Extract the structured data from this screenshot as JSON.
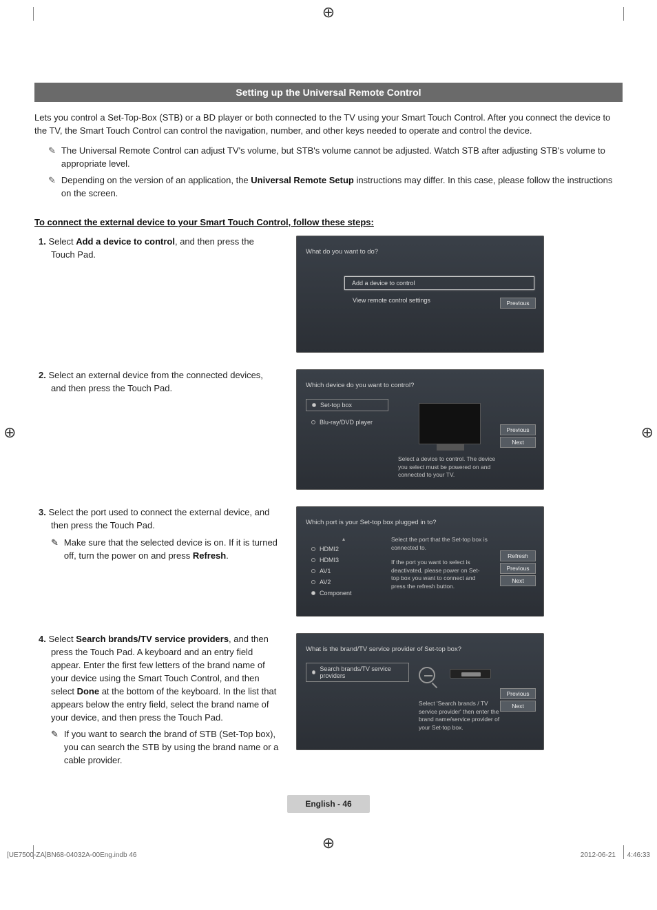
{
  "heading": "Setting up the Universal Remote Control",
  "intro": "Lets you control a Set-Top-Box (STB) or a BD player or both connected to the TV using your Smart Touch Control. After you connect the device to the TV, the Smart Touch Control can control the navigation, number, and other keys needed to operate and control the device.",
  "notes": [
    "The Universal Remote Control can adjust TV's volume, but STB's volume cannot be adjusted. Watch STB after adjusting STB's volume to appropriate level.",
    "Depending on the version of an application, the Universal Remote Setup instructions may differ. In this case, please follow the instructions on the screen."
  ],
  "note2_bold": "Universal Remote Setup",
  "subheading": "To connect the external device to your Smart Touch Control, follow these steps:",
  "steps": {
    "s1": {
      "num": "1.",
      "text_prefix": "Select ",
      "bold": "Add a device to control",
      "text_suffix": ", and then press the Touch Pad."
    },
    "s2": {
      "num": "2.",
      "text": "Select an external device from the connected devices, and then press the Touch Pad."
    },
    "s3": {
      "num": "3.",
      "text": "Select the port used to connect the external device, and then press the Touch Pad.",
      "note_prefix": "Make sure that the selected device is on. If it is turned off, turn the power on and press ",
      "note_bold": "Refresh",
      "note_suffix": "."
    },
    "s4": {
      "num": "4.",
      "text_prefix": "Select ",
      "bold1": "Search brands/TV service providers",
      "mid": ", and then press the Touch Pad. A keyboard and an entry field appear. Enter the first few letters of the brand name of your device using the Smart Touch Control, and then select ",
      "bold2": "Done",
      "suffix": " at the bottom of the keyboard. In the list that appears below the entry field, select the brand name of your device, and then press the Touch Pad.",
      "note": "If you want to search the brand of STB (Set-Top box), you can search the STB by using the brand name or a cable provider."
    }
  },
  "screen1": {
    "title": "What do you want to do?",
    "opt1": "Add a device to control",
    "opt2": "View remote control settings",
    "previous": "Previous"
  },
  "screen2": {
    "title": "Which device do you want to control?",
    "opt1": "Set-top box",
    "opt2": "Blu-ray/DVD player",
    "helper": "Select a device to control. The device you select must be powered on and connected to your TV.",
    "previous": "Previous",
    "next": "Next"
  },
  "screen3": {
    "title": "Which port is your Set-top box plugged in to?",
    "ports": [
      "HDMI2",
      "HDMI3",
      "AV1",
      "AV2",
      "Component"
    ],
    "helper1": "Select the port that the Set-top box is connected to.",
    "helper2": "If the port you want to select is deactivated, please power on Set-top box you want to connect and press the refresh button.",
    "refresh": "Refresh",
    "previous": "Previous",
    "next": "Next"
  },
  "screen4": {
    "title": "What is the brand/TV service provider of Set-top box?",
    "opt1": "Search brands/TV service providers",
    "helper": "Select 'Search brands / TV service provider' then enter the brand name/service provider of your Set-top box.",
    "previous": "Previous",
    "next": "Next"
  },
  "page_badge": "English - 46",
  "footer": {
    "left": "[UE7500-ZA]BN68-04032A-00Eng.indb   46",
    "right": "2012-06-21      4:46:33"
  }
}
